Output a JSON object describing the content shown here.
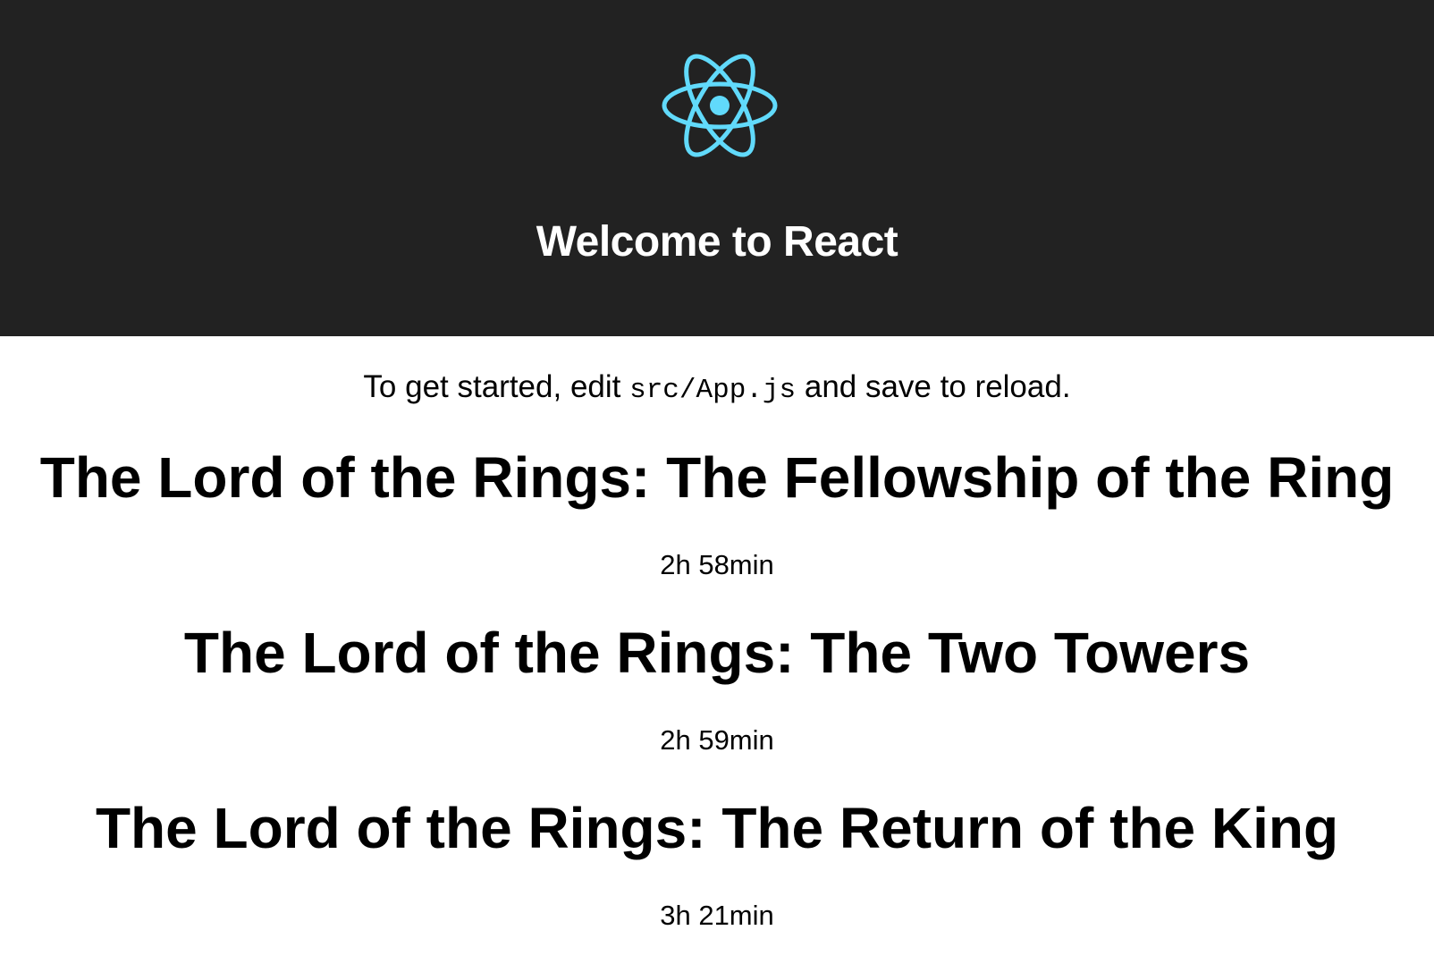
{
  "header": {
    "logo_icon": "react-atom-icon",
    "logo_color": "#61dafb",
    "background": "#222222",
    "title": "Welcome to React"
  },
  "intro": {
    "before": "To get started, edit ",
    "code": "src/App.js",
    "after": " and save to reload."
  },
  "movies": [
    {
      "title": "The Lord of the Rings: The Fellowship of the Ring",
      "duration": "2h 58min"
    },
    {
      "title": "The Lord of the Rings: The Two Towers",
      "duration": "2h 59min"
    },
    {
      "title": "The Lord of the Rings: The Return of the King",
      "duration": "3h 21min"
    }
  ]
}
